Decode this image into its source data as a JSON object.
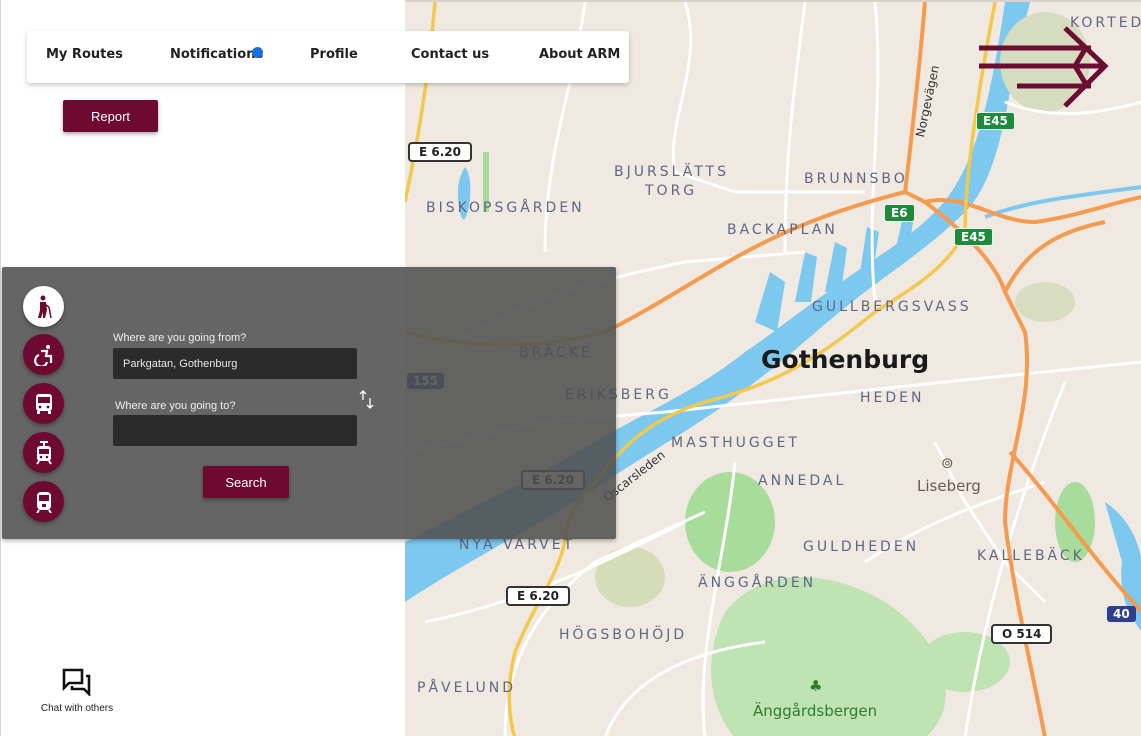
{
  "nav": {
    "items": [
      {
        "label": "My Routes"
      },
      {
        "label": "Notifications",
        "has_dot": true
      },
      {
        "label": "Profile"
      },
      {
        "label": "Contact us"
      },
      {
        "label": "About ARM"
      }
    ]
  },
  "report_button": {
    "label": "Report"
  },
  "route_panel": {
    "modes": [
      {
        "name": "elderly-walker",
        "icon": "elderly-person-icon",
        "active": true
      },
      {
        "name": "wheelchair",
        "icon": "wheelchair-icon",
        "active": false
      },
      {
        "name": "bus",
        "icon": "bus-icon",
        "active": false
      },
      {
        "name": "tram",
        "icon": "tram-icon",
        "active": false
      },
      {
        "name": "train",
        "icon": "train-icon",
        "active": false
      }
    ],
    "from_label": "Where are you going from?",
    "from_value": "Parkgatan, Gothenburg",
    "to_label": "Where are you going to?",
    "to_value": "",
    "swap_icon": "swap-vertical-icon",
    "search_label": "Search"
  },
  "chat": {
    "label": "Chat with others",
    "icon": "chat-bubbles-icon"
  },
  "forward_icon": "triple-arrow-right-icon",
  "colors": {
    "brand": "#6e0a2f",
    "notification_dot": "#1a6fe0",
    "panel": "#555555"
  },
  "map": {
    "city": "Gothenburg",
    "districts": [
      "BISKOPSGÅRDEN",
      "BJURSLÄTTS",
      "TORG",
      "BRUNNSBO",
      "BACKAPLAN",
      "GULLBERGSVASS",
      "HEDEN",
      "BRÄCKE",
      "ERIKSBERG",
      "MASTHUGGET",
      "ANNEDAL",
      "GULDHEDEN",
      "KALLEBÄCK",
      "NYA VARVET",
      "ÄNGGÅRDEN",
      "HÖGSBOHÖJD",
      "PÅVELUND",
      "KORTED"
    ],
    "pois": {
      "liseberg": "Liseberg",
      "park": "Änggårdsbergen"
    },
    "streets": {
      "norgevagen": "Norgevägen",
      "oscarsleden": "Oscarsleden"
    },
    "road_signs": {
      "e620_a": "E 6.20",
      "e620_b": "E 6.20",
      "e620_c": "E 6.20",
      "e6": "E6",
      "e45_a": "E45",
      "e45_b": "E45",
      "o514": "O 514",
      "r40": "40",
      "r155": "155"
    }
  }
}
